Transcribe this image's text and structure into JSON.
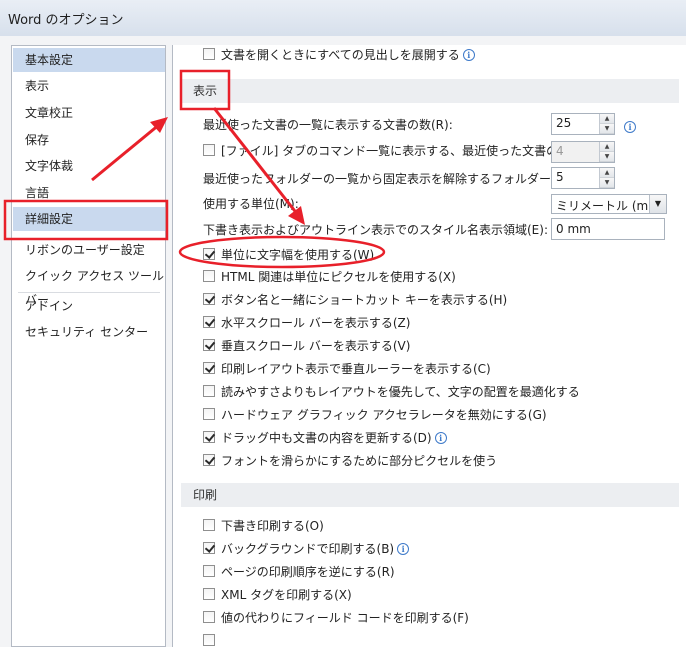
{
  "window": {
    "title": "Word のオプション"
  },
  "sidebar": {
    "items": [
      {
        "label": "基本設定"
      },
      {
        "label": "表示"
      },
      {
        "label": "文章校正"
      },
      {
        "label": "保存"
      },
      {
        "label": "文字体裁"
      },
      {
        "label": "言語"
      },
      {
        "label": "詳細設定"
      },
      {
        "label": "リボンのユーザー設定"
      },
      {
        "label": "クイック アクセス ツール バー"
      },
      {
        "label": "アドイン"
      },
      {
        "label": "セキュリティ センター"
      }
    ]
  },
  "main": {
    "top_row": {
      "label": "文書を開くときにすべての見出しを展開する",
      "checked": false
    },
    "display_section": {
      "title": "表示",
      "recent_docs": {
        "label": "最近使った文書の一覧に表示する文書の数(R):",
        "value": "25"
      },
      "file_tab": {
        "label": "[ファイル] タブのコマンド一覧に表示する、最近使った文書の数(Q):",
        "value": "4",
        "checked": false
      },
      "recent_folders": {
        "label": "最近使ったフォルダーの一覧から固定表示を解除するフォルダーの数(F):",
        "value": "5"
      },
      "units": {
        "label": "使用する単位(M):",
        "value": "ミリメートル (mm)"
      },
      "style_area": {
        "label": "下書き表示およびアウトライン表示でのスタイル名表示領域(E):",
        "value": "0 mm"
      },
      "options": [
        {
          "label": "単位に文字幅を使用する(W)",
          "checked": true
        },
        {
          "label": "HTML 関連は単位にピクセルを使用する(X)",
          "checked": false
        },
        {
          "label": "ボタン名と一緒にショートカット キーを表示する(H)",
          "checked": true
        },
        {
          "label": "水平スクロール バーを表示する(Z)",
          "checked": true
        },
        {
          "label": "垂直スクロール バーを表示する(V)",
          "checked": true
        },
        {
          "label": "印刷レイアウト表示で垂直ルーラーを表示する(C)",
          "checked": true
        },
        {
          "label": "読みやすさよりもレイアウトを優先して、文字の配置を最適化する",
          "checked": false
        },
        {
          "label": "ハードウェア グラフィック アクセラレータを無効にする(G)",
          "checked": false
        },
        {
          "label": "ドラッグ中も文書の内容を更新する(D)",
          "checked": true
        },
        {
          "label": "フォントを滑らかにするために部分ピクセルを使う",
          "checked": true
        }
      ]
    },
    "print_section": {
      "title": "印刷",
      "options": [
        {
          "label": "下書き印刷する(O)",
          "checked": false
        },
        {
          "label": "バックグラウンドで印刷する(B)",
          "checked": true
        },
        {
          "label": "ページの印刷順序を逆にする(R)",
          "checked": false
        },
        {
          "label": "XML タグを印刷する(X)",
          "checked": false
        },
        {
          "label": "値の代わりにフィールド コードを印刷する(F)",
          "checked": false
        }
      ]
    }
  },
  "colors": {
    "annotation_red": "#e8202a",
    "selection": "#c9d9ee"
  }
}
